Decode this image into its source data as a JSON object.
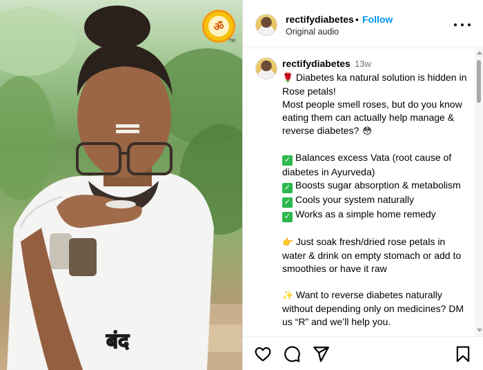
{
  "video": {
    "overlay_text": "बंद",
    "logo_tm": "TM",
    "logo_glyph": "ॐ"
  },
  "post": {
    "username": "rectifydiabetes",
    "separator": "•",
    "follow_label": "Follow",
    "audio_label": "Original audio"
  },
  "caption": {
    "username": "rectifydiabetes",
    "time_ago": "13w",
    "line1_emoji": "🌹",
    "line1": "Diabetes ka natural solution is hidden in Rose petals!",
    "line2": "Most people smell roses, but do you know eating them can actually help manage & reverse diabetes?",
    "line2_emoji": "😳",
    "bullets": [
      "Balances excess Vata (root cause of diabetes in Ayurveda)",
      "Boosts sugar absorption & metabolism",
      "Cools your system naturally",
      "Works as a simple home remedy"
    ],
    "tip_emoji": "👉",
    "tip": "Just soak fresh/dried rose petals in water & drink on empty stomach or add to smoothies or have it raw",
    "cta_emoji": "✨",
    "cta": "Want to reverse diabetes naturally without depending only on medicines? DM us “R” and we’ll help you."
  },
  "icons": {
    "like": "heart-icon",
    "comment": "comment-icon",
    "share": "share-icon",
    "save": "bookmark-icon",
    "more": "more-options-icon"
  },
  "colors": {
    "follow": "#0095f6",
    "check": "#2db84d",
    "overlay_text": "#e0161d"
  }
}
